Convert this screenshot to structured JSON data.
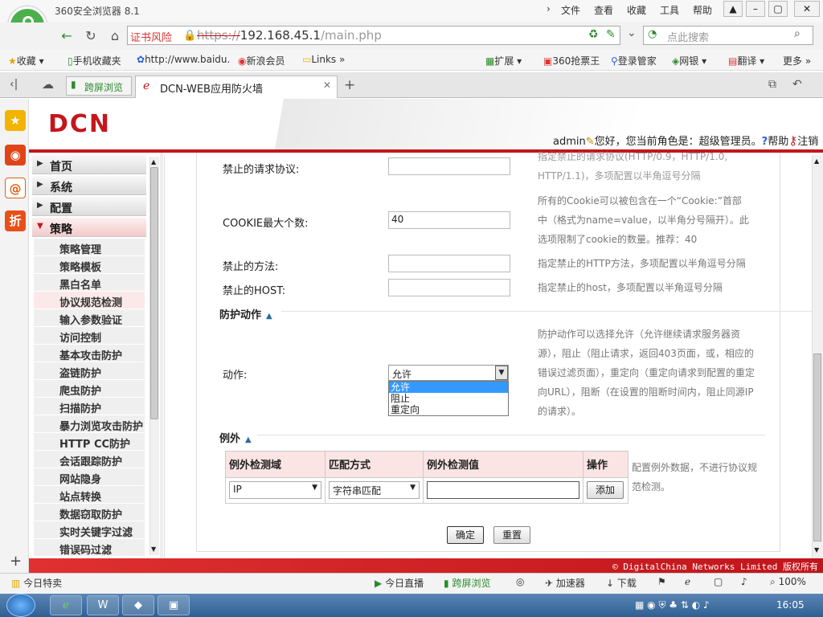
{
  "browser": {
    "app_name": "360安全浏览器 8.1",
    "menu": [
      "文件",
      "查看",
      "收藏",
      "工具",
      "帮助"
    ],
    "cert_warning": "证书风险",
    "url_protocol": "https://",
    "url_host": "192.168.45.1",
    "url_path": "/main.php",
    "search_placeholder": "点此搜索",
    "bookmarks": [
      "收藏",
      "手机收藏夹",
      "http://www.baidu.",
      "新浪会员",
      "Links"
    ],
    "bookmark_right": [
      "扩展",
      "360抢票王",
      "登录管家",
      "网银",
      "翻译",
      "更多"
    ],
    "tab_split": "跨屏浏览",
    "tab_active_title": "DCN-WEB应用防火墙"
  },
  "header": {
    "logo_text": "DCN",
    "username": "admin",
    "greeting": "您好，您当前角色是：超级管理员。",
    "help": "帮助",
    "logout": "注销"
  },
  "nav": {
    "main_items": [
      {
        "label": "首页",
        "open": false
      },
      {
        "label": "系统",
        "open": false
      },
      {
        "label": "配置",
        "open": false
      },
      {
        "label": "策略",
        "open": true
      }
    ],
    "sub_items": [
      "策略管理",
      "策略模板",
      "黑白名单",
      "协议规范检测",
      "输入参数验证",
      "访问控制",
      "基本攻击防护",
      "盗链防护",
      "爬虫防护",
      "扫描防护",
      "暴力浏览攻击防护",
      "HTTP CC防护",
      "会话跟踪防护",
      "网站隐身",
      "站点转换",
      "数据窃取防护",
      "实时关键字过滤",
      "错误码过滤"
    ],
    "selected_sub": "协议规范检测"
  },
  "form": {
    "rows": [
      {
        "label": "禁止的请求协议:",
        "value": "",
        "desc_lines": [
          "指定禁止的请求协议(HTTP/0.9，HTTP/1.0,",
          "HTTP/1.1)，多项配置以半角逗号分隔"
        ]
      },
      {
        "label": "COOKIE最大个数:",
        "value": "40",
        "desc_lines": [
          "所有的Cookie可以被包含在一个“Cookie:”首部",
          "中（格式为name=value，以半角分号隔开）。此",
          "选项限制了cookie的数量。推荐：40"
        ]
      },
      {
        "label": "禁止的方法:",
        "value": "",
        "desc_lines": [
          "指定禁止的HTTP方法，多项配置以半角逗号分隔"
        ]
      },
      {
        "label": "禁止的HOST:",
        "value": "",
        "desc_lines": [
          "指定禁止的host，多项配置以半角逗号分隔"
        ]
      }
    ],
    "section_action": "防护动作",
    "action_label": "动作:",
    "action_value": "允许",
    "action_options": [
      "允许",
      "阻止",
      "重定向"
    ],
    "action_desc_lines": [
      "防护动作可以选择允许（允许继续请求服务器资",
      "源），阻止（阻止请求，返回403页面，或，相应的",
      "错误过滤页面），重定向（重定向请求到配置的重定",
      "向URL），阻断（在设置的阻断时间内，阻止同源IP",
      "的请求）。"
    ],
    "section_exception": "例外",
    "table_headers": [
      "例外检测域",
      "匹配方式",
      "例外检测值",
      "操作"
    ],
    "table_row": {
      "domain": "IP",
      "match": "字符串匹配",
      "value": "",
      "add": "添加"
    },
    "exception_desc_lines": [
      "配置例外数据，不进行协议规",
      "范检测。"
    ],
    "confirm": "确定",
    "reset": "重置"
  },
  "footer_text": "© DigitalChina Networks Limited 版权所有",
  "statusbar": {
    "left": "今日特卖",
    "items": [
      "今日直播",
      "跨屏浏览",
      "加速器",
      "下载"
    ],
    "zoom": "100%"
  },
  "taskbar": {
    "clock": "16:05"
  }
}
